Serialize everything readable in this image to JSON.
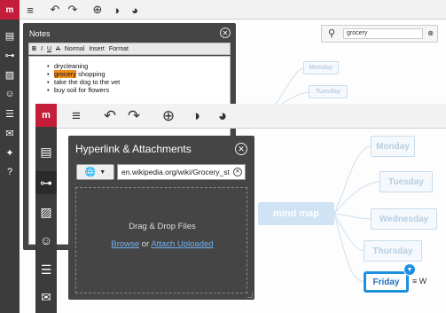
{
  "app": {
    "logo_text": "m"
  },
  "toolbar": {
    "icons": [
      "menu-icon",
      "undo-icon",
      "redo-icon",
      "add-icon",
      "connect-icon",
      "palette-icon"
    ]
  },
  "notes_panel": {
    "title": "Notes",
    "toolbar": {
      "bold": "B",
      "italic": "I",
      "underline": "U",
      "strike": "A",
      "style": "Normal",
      "insert": "Insert",
      "format": "Format"
    },
    "items": [
      {
        "pre": "",
        "highlight": "",
        "post": "drycleaning"
      },
      {
        "pre": "",
        "highlight": "grocery",
        "post": " shopping"
      },
      {
        "pre": "",
        "highlight": "",
        "post": "take the dog to the vet"
      },
      {
        "pre": "",
        "highlight": "",
        "post": "buy soil for flowers"
      }
    ]
  },
  "search": {
    "value": "grocery"
  },
  "mindmap": {
    "center": "mind map",
    "back_nodes": [
      "Monday",
      "Tuesday"
    ],
    "front_nodes": [
      "Monday",
      "Tuesday",
      "Wednesday",
      "Thursday"
    ],
    "selected": "Friday",
    "selected_extras": "≡ W"
  },
  "hyperlink_panel": {
    "title": "Hyperlink & Attachments",
    "url": "en.wikipedia.org/wiki/Grocery_st",
    "drop_title": "Drag & Drop Files",
    "browse": "Browse",
    "or": " or ",
    "attach": "Attach Uploaded"
  },
  "colors": {
    "brand": "#c41e3a",
    "sidebar": "#3c3c3c",
    "panel": "#454545",
    "accent": "#1d8fe1"
  }
}
